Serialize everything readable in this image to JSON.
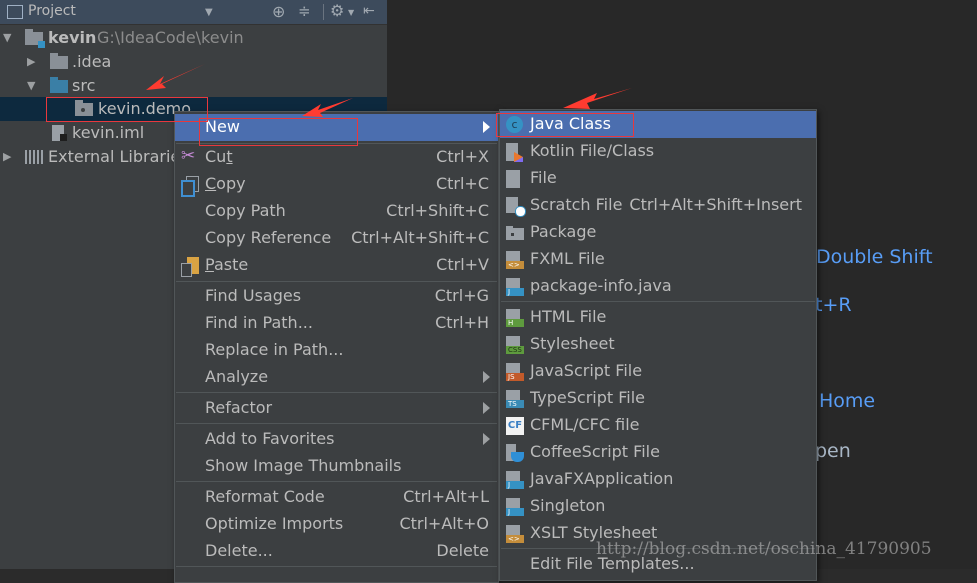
{
  "panel": {
    "title": "Project",
    "tree": [
      {
        "name": "kevin",
        "path": "G:\\IdeaCode\\kevin",
        "expanded": true
      },
      {
        "name": ".idea",
        "expanded": false
      },
      {
        "name": "src",
        "expanded": true
      },
      {
        "name": "kevin.demo",
        "selected": true
      },
      {
        "name": "kevin.iml"
      },
      {
        "name": "External Libraries",
        "expanded": false
      }
    ]
  },
  "editor_hints": {
    "search": "Double Shift",
    "recent": "t+R",
    "nav": "Home",
    "open": "pen"
  },
  "context_menu": {
    "items": [
      {
        "label": "New",
        "has_submenu": true,
        "highlighted": true
      },
      {
        "label": "Cut",
        "mnemonic": "t",
        "shortcut": "Ctrl+X",
        "icon": "cut-icon"
      },
      {
        "label": "Copy",
        "mnemonic": "C",
        "shortcut": "Ctrl+C",
        "icon": "copy-icon"
      },
      {
        "label": "Copy Path",
        "shortcut": "Ctrl+Shift+C"
      },
      {
        "label": "Copy Reference",
        "shortcut": "Ctrl+Alt+Shift+C"
      },
      {
        "label": "Paste",
        "mnemonic": "P",
        "shortcut": "Ctrl+V",
        "icon": "paste-icon"
      },
      {
        "label": "Find Usages",
        "shortcut": "Ctrl+G"
      },
      {
        "label": "Find in Path...",
        "shortcut": "Ctrl+H"
      },
      {
        "label": "Replace in Path..."
      },
      {
        "label": "Analyze",
        "has_submenu": true
      },
      {
        "label": "Refactor",
        "has_submenu": true
      },
      {
        "label": "Add to Favorites",
        "has_submenu": true
      },
      {
        "label": "Show Image Thumbnails"
      },
      {
        "label": "Reformat Code",
        "shortcut": "Ctrl+Alt+L"
      },
      {
        "label": "Optimize Imports",
        "shortcut": "Ctrl+Alt+O"
      },
      {
        "label": "Delete...",
        "shortcut": "Delete"
      }
    ]
  },
  "new_submenu": {
    "items": [
      {
        "label": "Java Class",
        "icon": "java-class-icon",
        "highlighted": true
      },
      {
        "label": "Kotlin File/Class",
        "icon": "kotlin-file-icon"
      },
      {
        "label": "File",
        "icon": "file-icon"
      },
      {
        "label": "Scratch File",
        "shortcut": "Ctrl+Alt+Shift+Insert",
        "icon": "scratch-file-icon"
      },
      {
        "label": "Package",
        "icon": "package-icon"
      },
      {
        "label": "FXML File",
        "icon": "fxml-file-icon"
      },
      {
        "label": "package-info.java",
        "icon": "package-info-icon"
      },
      {
        "label": "HTML File",
        "icon": "html-file-icon"
      },
      {
        "label": "Stylesheet",
        "icon": "css-file-icon"
      },
      {
        "label": "JavaScript File",
        "icon": "js-file-icon"
      },
      {
        "label": "TypeScript File",
        "icon": "ts-file-icon"
      },
      {
        "label": "CFML/CFC file",
        "icon": "cfml-file-icon"
      },
      {
        "label": "CoffeeScript File",
        "icon": "coffeescript-file-icon"
      },
      {
        "label": "JavaFXApplication",
        "icon": "javafx-icon"
      },
      {
        "label": "Singleton",
        "icon": "singleton-icon"
      },
      {
        "label": "XSLT Stylesheet",
        "icon": "xslt-file-icon"
      },
      {
        "label": "Edit File Templates..."
      }
    ]
  },
  "icon_tags": {
    "fxml": "<>",
    "java": "J",
    "html": "H",
    "css": "CSS",
    "js": "JS",
    "ts": "TS",
    "cf": "CF",
    "c": "c"
  },
  "colors": {
    "highlight": "#4b6eaf",
    "annotation": "#e8383d",
    "hint_link": "#589df6"
  },
  "watermark": "http://blog.csdn.net/oschina_41790905"
}
